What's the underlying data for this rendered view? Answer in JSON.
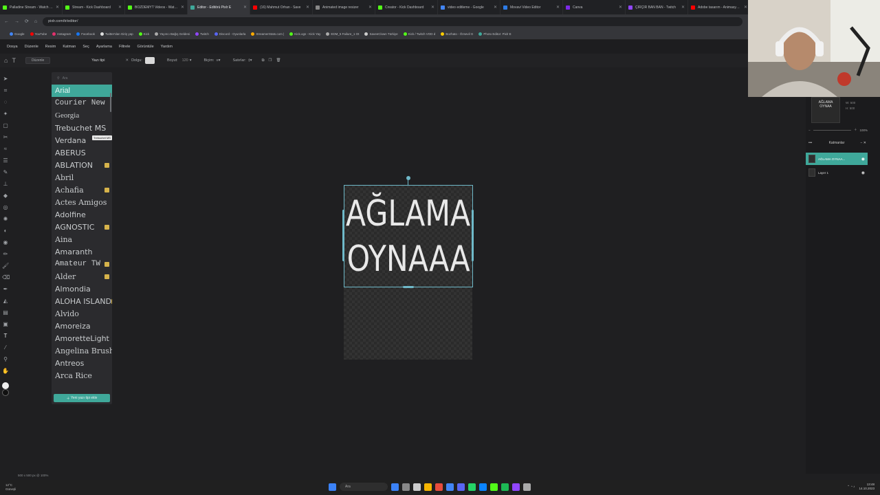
{
  "browser": {
    "tabs": [
      {
        "title": "Palladine Stream - Watch Live",
        "color": "#53fc18",
        "active": false
      },
      {
        "title": "Stream - Kick Dashboard",
        "color": "#53fc18",
        "active": false
      },
      {
        "title": "BOZDEMYT Videos - Watch Cl",
        "color": "#53fc18",
        "active": false
      },
      {
        "title": "Editor - Editörü Pixlr E",
        "color": "#3fa89a",
        "active": true
      },
      {
        "title": "(16) Mahmut Orhan - Save",
        "color": "#ff0000",
        "active": false
      },
      {
        "title": "Animated image resizer",
        "color": "#888888",
        "active": false
      },
      {
        "title": "Creator - Kick Dashboard",
        "color": "#53fc18",
        "active": false
      },
      {
        "title": "video editleme - Google",
        "color": "#4285f4",
        "active": false
      },
      {
        "title": "Movavi Video Editor",
        "color": "#2d7be5",
        "active": false
      },
      {
        "title": "Canva",
        "color": "#7d2ae8",
        "active": false
      },
      {
        "title": "ÇIRÇIR BAN BAN - Twitch",
        "color": "#9146ff",
        "active": false
      },
      {
        "title": "Adobe tasarım - Animasyonlu",
        "color": "#ff0000",
        "active": false
      }
    ],
    "url": "pixlr.com/tr/editor/",
    "bookmarks": [
      {
        "label": "Google",
        "color": "#4285f4"
      },
      {
        "label": "YouTube",
        "color": "#ff0000"
      },
      {
        "label": "Instagram",
        "color": "#e1306c"
      },
      {
        "label": "Facebook",
        "color": "#1877f2"
      },
      {
        "label": "Twitter'dan Giriş yap",
        "color": "#dddddd"
      },
      {
        "label": "Kick",
        "color": "#53fc18"
      },
      {
        "label": "Yayıncı Bağış Geldesi",
        "color": "#aaaaaa"
      },
      {
        "label": "Twitch",
        "color": "#9146ff"
      },
      {
        "label": "Discord - Oyunlarla",
        "color": "#5865f2"
      },
      {
        "label": "StreamerStats.com |",
        "color": "#ffaa00"
      },
      {
        "label": "Kick.ogs - Kick Yay",
        "color": "#53fc18"
      },
      {
        "label": "EDM_5 Failure_1 Ot",
        "color": "#aaaaaa"
      },
      {
        "label": "SaveeClown Türkiye",
        "color": "#cccccc"
      },
      {
        "label": "Kick / Twitch VOD d",
        "color": "#53fc18"
      },
      {
        "label": "Bozhato - Özsevil G",
        "color": "#ffcc00"
      },
      {
        "label": "Photo Editor: Pixlr E",
        "color": "#3fa89a"
      }
    ]
  },
  "menu": [
    "Dosya",
    "Düzenle",
    "Resim",
    "Katman",
    "Seç",
    "Ayarlama",
    "Filtrele",
    "Görüntüle",
    "Yardım"
  ],
  "options": {
    "edit_label": "Düzenle",
    "panel_title": "Yazı tipi",
    "fill_label": "Dolgu:",
    "size_label": "Boyut:",
    "size_value": "120",
    "style_label": "Biçim:",
    "lines_label": "Satırlar:"
  },
  "font_panel": {
    "search_placeholder": "Ara",
    "fonts": [
      {
        "name": "Arial",
        "selected": true,
        "premium": false,
        "family": "\"Liberation Sans\", sans-serif"
      },
      {
        "name": "Courier New",
        "selected": false,
        "premium": false,
        "family": "\"Liberation Mono\", monospace"
      },
      {
        "name": "Georgia",
        "selected": false,
        "premium": false,
        "family": "\"Liberation Serif\", serif"
      },
      {
        "name": "Trebuchet MS",
        "selected": false,
        "premium": false,
        "family": "\"DejaVu Sans\", sans-serif"
      },
      {
        "name": "Verdana",
        "selected": false,
        "premium": false,
        "family": "\"DejaVu Sans\", sans-serif"
      },
      {
        "name": "ABERUS",
        "selected": false,
        "premium": false,
        "family": "\"DejaVu Sans\", sans-serif"
      },
      {
        "name": "ABLATION",
        "selected": false,
        "premium": true,
        "family": "\"DejaVu Sans\", sans-serif"
      },
      {
        "name": "Abril",
        "selected": false,
        "premium": false,
        "family": "\"DejaVu Serif\", serif"
      },
      {
        "name": "Achafia",
        "selected": false,
        "premium": true,
        "family": "\"DejaVu Serif\", serif"
      },
      {
        "name": "Actes Amigos",
        "selected": false,
        "premium": false,
        "family": "\"DejaVu Serif\", serif"
      },
      {
        "name": "Adolfine",
        "selected": false,
        "premium": false,
        "family": "\"DejaVu Sans\", sans-serif"
      },
      {
        "name": "AGNOSTIC",
        "selected": false,
        "premium": true,
        "family": "\"DejaVu Sans\", sans-serif"
      },
      {
        "name": "Aina",
        "selected": false,
        "premium": false,
        "family": "\"DejaVu Serif\", serif"
      },
      {
        "name": "Amaranth",
        "selected": false,
        "premium": false,
        "family": "\"DejaVu Sans\", sans-serif"
      },
      {
        "name": "Amateur TW",
        "selected": false,
        "premium": true,
        "family": "\"Liberation Mono\", monospace"
      },
      {
        "name": "Alder",
        "selected": false,
        "premium": true,
        "family": "\"DejaVu Serif\", serif"
      },
      {
        "name": "Almondia",
        "selected": false,
        "premium": false,
        "family": "\"DejaVu Sans\", sans-serif"
      },
      {
        "name": "ALOHA ISLAND",
        "selected": false,
        "premium": true,
        "family": "\"DejaVu Sans\", sans-serif"
      },
      {
        "name": "Alvido",
        "selected": false,
        "premium": false,
        "family": "\"DejaVu Serif\", serif"
      },
      {
        "name": "Amoreiza",
        "selected": false,
        "premium": false,
        "family": "\"DejaVu Sans\", sans-serif"
      },
      {
        "name": "AmoretteLight",
        "selected": false,
        "premium": false,
        "family": "\"DejaVu Sans\", sans-serif"
      },
      {
        "name": "Angelina Brush Script",
        "selected": false,
        "premium": true,
        "family": "\"DejaVu Serif\", serif"
      },
      {
        "name": "Antreos",
        "selected": false,
        "premium": false,
        "family": "\"DejaVu Sans\", sans-serif"
      },
      {
        "name": "Arca Rice",
        "selected": false,
        "premium": false,
        "family": "\"DejaVu Serif\", serif"
      }
    ],
    "tooltip": "Trebuchet MS",
    "add_button": "Yeni yazı tipi ekle"
  },
  "canvas": {
    "line1": "AĞLAMA",
    "line2": "OYNAAA"
  },
  "navigator": {
    "thumb_line1": "AĞLAMA",
    "thumb_line2": "OYNAA",
    "w_label": "W:",
    "w_value": "500",
    "h_label": "H:",
    "h_value": "500",
    "zoom": "100%"
  },
  "layers": {
    "title": "Katmanlar",
    "items": [
      {
        "name": "AĞLAMA OYNAA...",
        "selected": true
      },
      {
        "name": "Layer 1",
        "selected": false
      }
    ]
  },
  "status": "500 x 500 px @ 100%",
  "taskbar": {
    "temp": "12°C",
    "weather": "Güneşli",
    "search": "Ara",
    "time": "13:48",
    "date": "14.10.2023",
    "app_colors": [
      "#3b82f6",
      "#888888",
      "#cccccc",
      "#f5b400",
      "#e74c3c",
      "#4285f4",
      "#5865f2",
      "#25d366",
      "#0a84ff",
      "#53fc18",
      "#1db954",
      "#9146ff",
      "#aaaaaa"
    ]
  }
}
